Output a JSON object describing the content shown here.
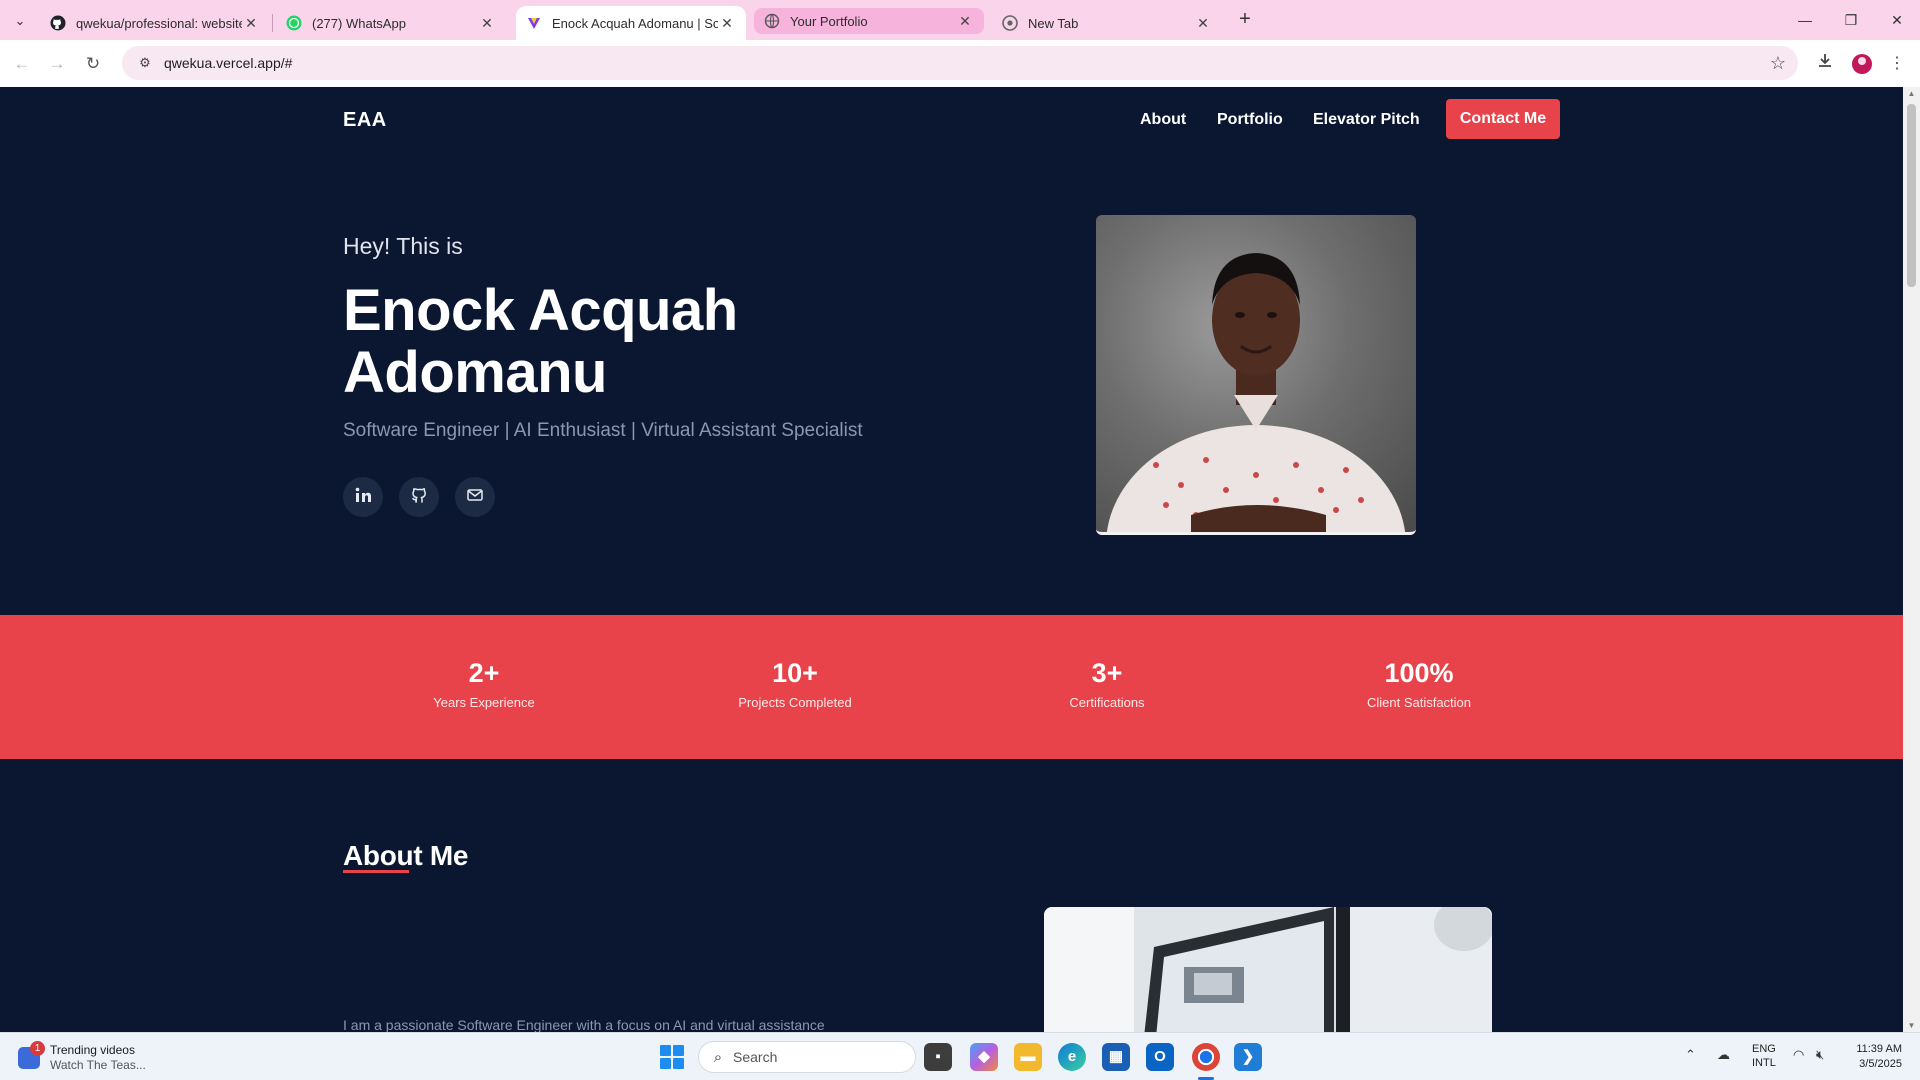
{
  "browser": {
    "tabs": [
      {
        "title": "qwekua/professional: website",
        "icon": "github-icon",
        "state": "normal"
      },
      {
        "title": "(277) WhatsApp",
        "icon": "whatsapp-icon",
        "state": "normal"
      },
      {
        "title": "Enock Acquah Adomanu | Softw",
        "icon": "vercel-icon",
        "state": "active"
      },
      {
        "title": "Your Portfolio",
        "icon": "globe-icon",
        "state": "highlighted"
      },
      {
        "title": "New Tab",
        "icon": "chrome-icon",
        "state": "normal"
      }
    ],
    "url": "qwekua.vercel.app/#",
    "colors": {
      "tab_strip": "#f9d4ea",
      "highlighted_tab": "#f6b3dc",
      "omnibox": "#f8e8f2"
    }
  },
  "site": {
    "logo": "EAA",
    "nav": {
      "about": "About",
      "portfolio": "Portfolio",
      "elevator_pitch": "Elevator Pitch",
      "contact": "Contact Me"
    },
    "hero": {
      "greeting": "Hey! This is",
      "name_line1": "Enock Acquah",
      "name_line2": "Adomanu",
      "tagline": "Software Engineer | AI Enthusiast | Virtual Assistant Specialist",
      "socials": [
        "linkedin-icon",
        "github-icon",
        "mail-icon"
      ]
    },
    "stats": [
      {
        "value": "2+",
        "label": "Years Experience"
      },
      {
        "value": "10+",
        "label": "Projects Completed"
      },
      {
        "value": "3+",
        "label": "Certifications"
      },
      {
        "value": "100%",
        "label": "Client Satisfaction"
      }
    ],
    "about": {
      "title": "About Me",
      "intro": "I am a passionate Software Engineer with a focus on AI and virtual assistance"
    },
    "colors": {
      "background": "#0b1730",
      "accent": "#e8434a",
      "muted_text": "#8a97ae"
    }
  },
  "taskbar": {
    "news_title": "Trending videos",
    "news_sub": "Watch The Teas...",
    "news_badge": "1",
    "search_label": "Search",
    "lang_line1": "ENG",
    "lang_line2": "INTL",
    "time": "11:39 AM",
    "date": "3/5/2025"
  }
}
